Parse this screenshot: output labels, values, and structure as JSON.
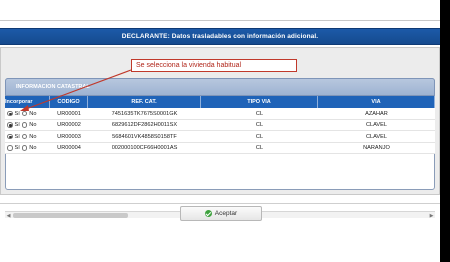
{
  "declarante": {
    "title": "DECLARANTE: Datos trasladables con información adicional."
  },
  "catastral": {
    "section_title": "INFORMACION CATASTRAL",
    "columns": [
      "Incorporar",
      "CODIGO",
      "REF. CAT.",
      "TIPO VIA",
      "VIA"
    ],
    "rows": [
      {
        "si_label": "Sí",
        "no_label": "No",
        "selected": "Sí",
        "codigo": "UR00001",
        "ref_cat": "7451635TK7675S0001GK",
        "tipo_via": "CL",
        "via": "AZAHAR"
      },
      {
        "si_label": "Sí",
        "no_label": "No",
        "selected": "Sí",
        "codigo": "UR00002",
        "ref_cat": "6829612DF2862H0011SX",
        "tipo_via": "CL",
        "via": "CLAVEL"
      },
      {
        "si_label": "Sí",
        "no_label": "No",
        "selected": "Sí",
        "codigo": "UR00003",
        "ref_cat": "5684601VK4858S0158TF",
        "tipo_via": "CL",
        "via": "CLAVEL"
      },
      {
        "si_label": "Sí",
        "no_label": "No",
        "selected": "none",
        "codigo": "UR00004",
        "ref_cat": "002000100CF66H0001AS",
        "tipo_via": "CL",
        "via": "NARANJO"
      }
    ]
  },
  "annotation": {
    "text": "Se selecciona la vivienda habitual"
  },
  "footer": {
    "accept_label": "Aceptar",
    "accept_icon": "check-icon"
  },
  "colors": {
    "header_blue": "#1c5aa8",
    "grid_header_blue": "#1f63b8",
    "annotation_red": "#c0392b",
    "accept_green": "#3ea23e"
  }
}
